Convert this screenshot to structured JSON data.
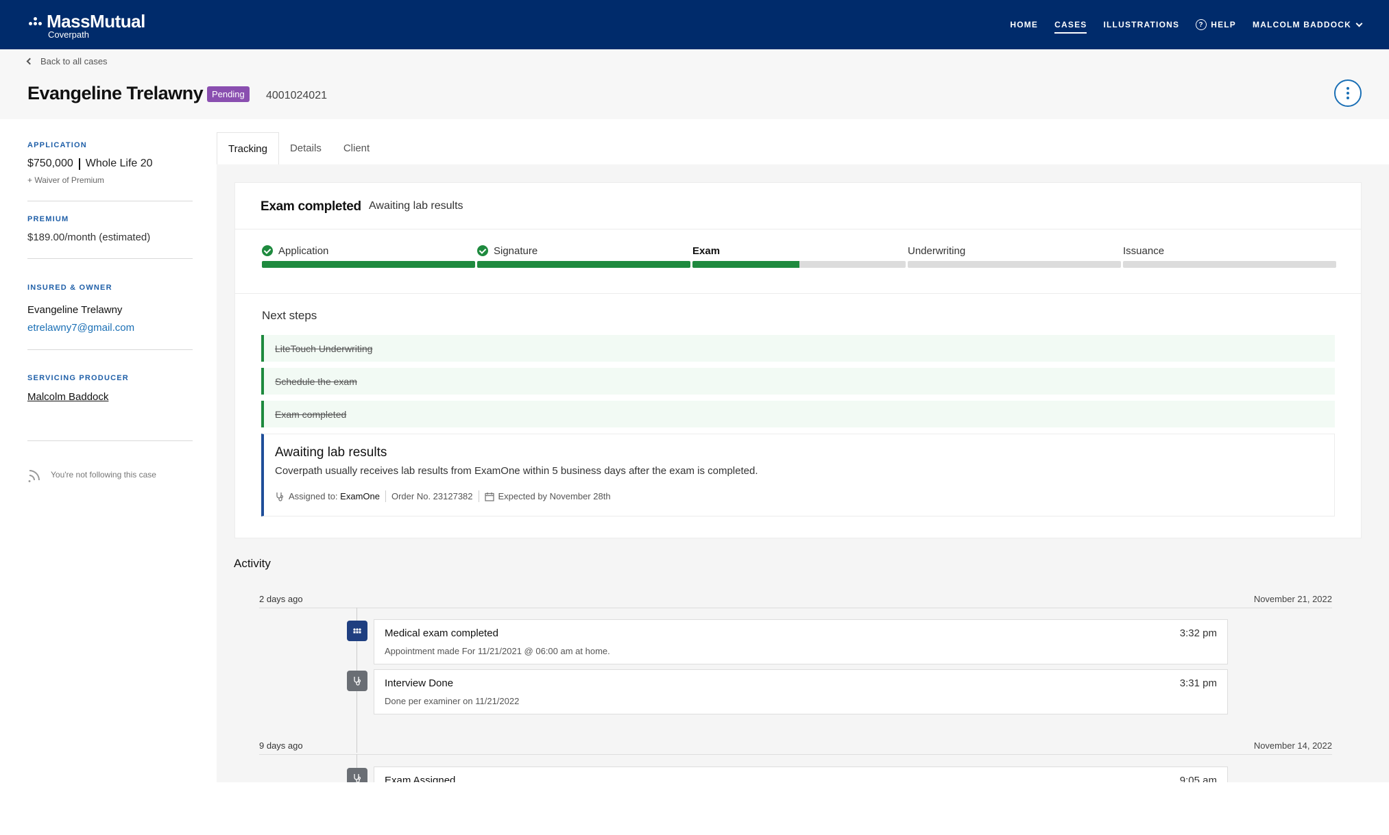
{
  "brand": {
    "name": "MassMutual",
    "sub": "Coverpath"
  },
  "nav": {
    "home": "HOME",
    "cases": "CASES",
    "illustrations": "ILLUSTRATIONS",
    "help": "HELP",
    "user": "MALCOLM BADDOCK"
  },
  "header": {
    "back": "Back to all cases",
    "client_name": "Evangeline Trelawny",
    "status": "Pending",
    "policy_number": "4001024021"
  },
  "sidebar": {
    "application_label": "APPLICATION",
    "amount": "$750,000",
    "product": "Whole Life 20",
    "rider": "+ Waiver of Premium",
    "premium_label": "PREMIUM",
    "premium": "$189.00/month (estimated)",
    "insured_label": "INSURED & OWNER",
    "insured_name": "Evangeline Trelawny",
    "insured_email": "etrelawny7@gmail.com",
    "producer_label": "SERVICING PRODUCER",
    "producer": "Malcolm Baddock",
    "follow_text": "You're not following this case"
  },
  "tabs": [
    "Tracking",
    "Details",
    "Client"
  ],
  "status_card": {
    "title": "Exam completed",
    "subtitle": "Awaiting lab results",
    "steps": [
      {
        "label": "Application",
        "complete": true,
        "progress": 1.0
      },
      {
        "label": "Signature",
        "complete": true,
        "progress": 1.0
      },
      {
        "label": "Exam",
        "complete": false,
        "current": true,
        "progress": 0.5
      },
      {
        "label": "Underwriting",
        "complete": false,
        "progress": 0
      },
      {
        "label": "Issuance",
        "complete": false,
        "progress": 0
      }
    ],
    "next_steps_title": "Next steps",
    "done_steps": [
      "LiteTouch Underwriting",
      "Schedule the exam",
      "Exam completed"
    ],
    "active_step": {
      "title": "Awaiting lab results",
      "description": "Coverpath usually receives lab results from ExamOne within 5 business days after the exam is completed.",
      "assigned_label": "Assigned to:",
      "assigned_to": "ExamOne",
      "order": "Order No. 23127382",
      "expected": "Expected by November 28th"
    }
  },
  "activity": {
    "title": "Activity",
    "groups": [
      {
        "relative": "2 days ago",
        "date": "November 21, 2022",
        "items": [
          {
            "title": "Medical exam completed",
            "time": "3:32 pm",
            "desc": "Appointment made For 11/21/2021 @ 06:00 am at home.",
            "icon": "people-icon"
          },
          {
            "title": "Interview Done",
            "time": "3:31 pm",
            "desc": "Done per examiner on 11/21/2022",
            "icon": "stethoscope-icon"
          }
        ]
      },
      {
        "relative": "9 days ago",
        "date": "November 14, 2022",
        "items": [
          {
            "title": "Exam Assigned",
            "time": "9:05 am",
            "desc": "",
            "icon": "stethoscope-icon"
          }
        ]
      }
    ]
  },
  "colors": {
    "nav_bg": "#002b6b",
    "success": "#1e8a3e",
    "pending": "#8a4fb0",
    "link": "#1a6fb5"
  }
}
